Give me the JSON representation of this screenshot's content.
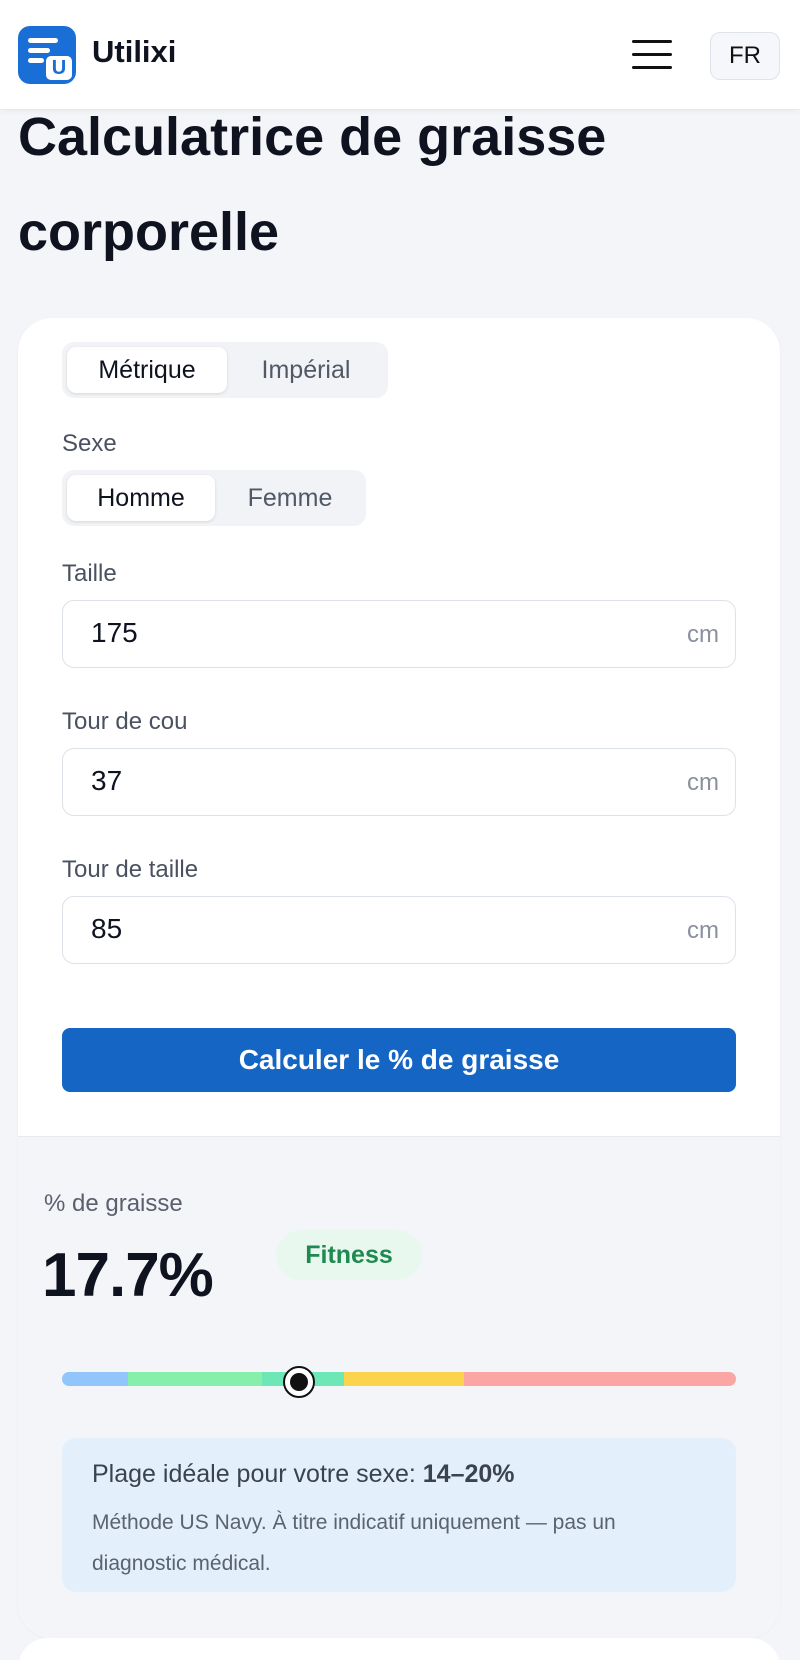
{
  "header": {
    "brand": "Utilixi",
    "logo_letter": "U",
    "menu_icon": "hamburger-menu-icon",
    "language": "FR"
  },
  "page": {
    "title": "Calculatrice de graisse corporelle"
  },
  "form": {
    "units": {
      "options": [
        "Métrique",
        "Impérial"
      ],
      "selected": "Métrique"
    },
    "sex": {
      "label": "Sexe",
      "options": [
        "Homme",
        "Femme"
      ],
      "selected": "Homme"
    },
    "height": {
      "label": "Taille",
      "value": "175",
      "unit": "cm"
    },
    "neck": {
      "label": "Tour de cou",
      "value": "37",
      "unit": "cm"
    },
    "waist": {
      "label": "Tour de taille",
      "value": "85",
      "unit": "cm"
    },
    "submit_label": "Calculer le % de graisse"
  },
  "result": {
    "label": "% de graisse",
    "value": "17.7%",
    "category": "Fitness",
    "gauge_position_percent": 17.7,
    "gauge_colors": [
      "#93c5fd",
      "#86efac",
      "#6ee7b7",
      "#fcd34d",
      "#fca5a5"
    ],
    "ideal_prefix": "Plage idéale pour votre sexe:",
    "ideal_range": "14–20%",
    "disclaimer": "Méthode US Navy. À titre indicatif uniquement — pas un diagnostic médical."
  },
  "colors": {
    "brand": "#1a6fd6",
    "primary_button": "#1565c4",
    "fitness_badge_text": "#1f8a4f",
    "info_background": "#e3f0fb"
  }
}
